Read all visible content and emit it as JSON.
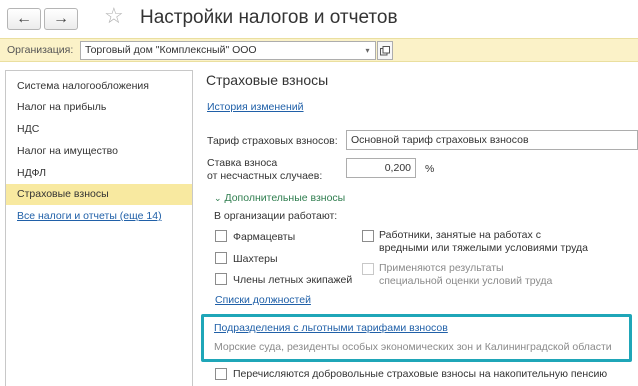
{
  "window": {
    "title": "Настройки налогов и отчетов",
    "back_icon": "←",
    "forward_icon": "→",
    "favorite_icon": "☆"
  },
  "org": {
    "label": "Организация:",
    "value": "Торговый дом \"Комплексный\" ООО",
    "dropdown_icon": "▾"
  },
  "sidebar": {
    "items": [
      {
        "label": "Система налогообложения"
      },
      {
        "label": "Налог на прибыль"
      },
      {
        "label": "НДС"
      },
      {
        "label": "Налог на имущество"
      },
      {
        "label": "НДФЛ"
      },
      {
        "label": "Страховые взносы"
      },
      {
        "label": "Все налоги и отчеты (еще 14)"
      }
    ]
  },
  "main": {
    "title": "Страховые взносы",
    "history_link": "История изменений",
    "tariff_label": "Тариф страховых взносов:",
    "tariff_value": "Основной тариф страховых взносов",
    "rate_label_1": "Ставка взноса",
    "rate_label_2": "от несчастных случаев:",
    "rate_value": "0,200",
    "rate_unit": "%",
    "extra_group": "Дополнительные взносы",
    "org_works": "В организации работают:",
    "pharmacists": "Фармацевты",
    "miners": "Шахтеры",
    "aircrew": "Члены летных экипажей",
    "hazard_1": "Работники, занятые на работах с",
    "hazard_2": "вредными или тяжелыми условиями труда",
    "assess_1": "Применяются результаты",
    "assess_2": "специальной оценки условий труда",
    "positions_link": "Списки должностей",
    "divisions_link": "Подразделения с льготными тарифами взносов",
    "divisions_note": "Морские суда, резиденты особых экономических зон и Калининградской области",
    "voluntary": "Перечисляются добровольные страховые взносы на накопительную пенсию"
  }
}
